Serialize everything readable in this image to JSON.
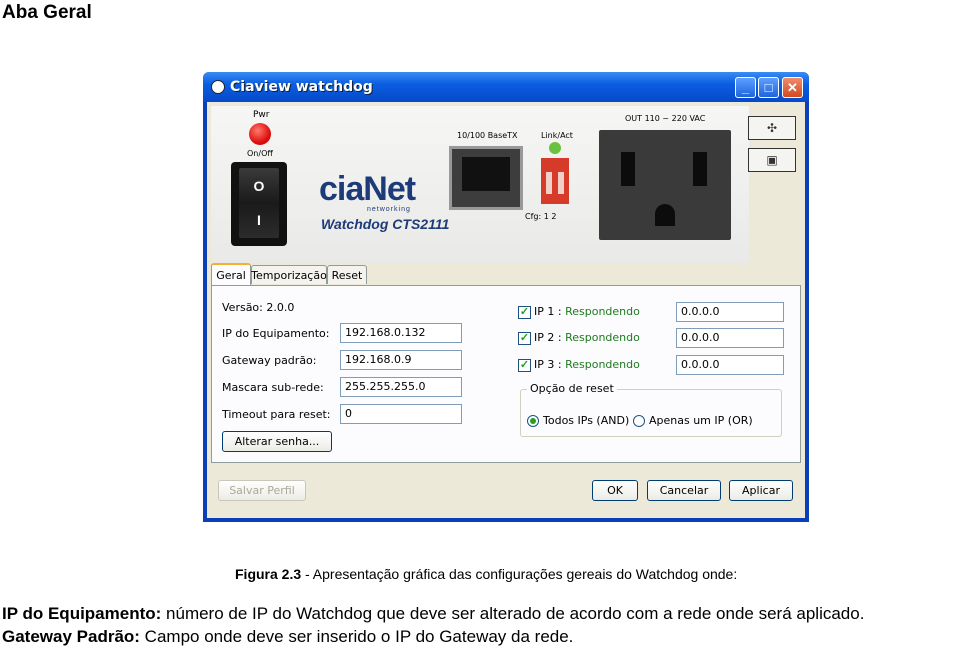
{
  "heading": "Aba Geral",
  "window": {
    "title": "Ciaview watchdog",
    "min_symbol": "_",
    "max_symbol": "□",
    "close_symbol": "✕"
  },
  "device": {
    "pwr_label": "Pwr",
    "onoff_label": "On/Off",
    "switch_o": "O",
    "switch_i": "I",
    "logo_text": "ciaNet",
    "logo_sub": "networking",
    "model": "Watchdog CTS2111",
    "ethernet_label": "10/100 BaseTX",
    "link_label": "Link/Act",
    "cfg_label": "Cfg: 1    2",
    "outlet_label": "OUT 110 ~ 220 VAC"
  },
  "tabs": [
    "Geral",
    "Temporização",
    "Reset"
  ],
  "geral": {
    "versao": "Versão: 2.0.0",
    "ip_label": "IP do Equipamento:",
    "ip_value": "192.168.0.132",
    "gateway_label": "Gateway padrão:",
    "gateway_value": "192.168.0.9",
    "mascara_label": "Mascara sub-rede:",
    "mascara_value": "255.255.255.0",
    "timeout_label": "Timeout para reset:",
    "timeout_value": "0",
    "alterar_senha": "Alterar senha..."
  },
  "monitor": [
    {
      "label": "IP 1 :",
      "status": "Respondendo",
      "value": "0.0.0.0"
    },
    {
      "label": "IP 2 :",
      "status": "Respondendo",
      "value": "0.0.0.0"
    },
    {
      "label": "IP 3 :",
      "status": "Respondendo",
      "value": "0.0.0.0"
    }
  ],
  "reset_option": {
    "title": "Opção de reset",
    "option_and": "Todos IPs (AND)",
    "option_or": "Apenas um IP (OR)"
  },
  "footer": {
    "salvar": "Salvar Perfil",
    "ok": "OK",
    "cancelar": "Cancelar",
    "aplicar": "Aplicar"
  },
  "caption": {
    "figure": "Figura 2.3",
    "text": " - Apresentação gráfica das configurações gereais do Watchdog onde:"
  },
  "paragraphs": {
    "ip_term": "IP do Equipamento:",
    "ip_desc": " número de IP do Watchdog que deve ser alterado de acordo com a rede onde será aplicado.",
    "gw_term": "Gateway Padrão:",
    "gw_desc": " Campo onde deve ser inserido o IP do Gateway da rede."
  }
}
